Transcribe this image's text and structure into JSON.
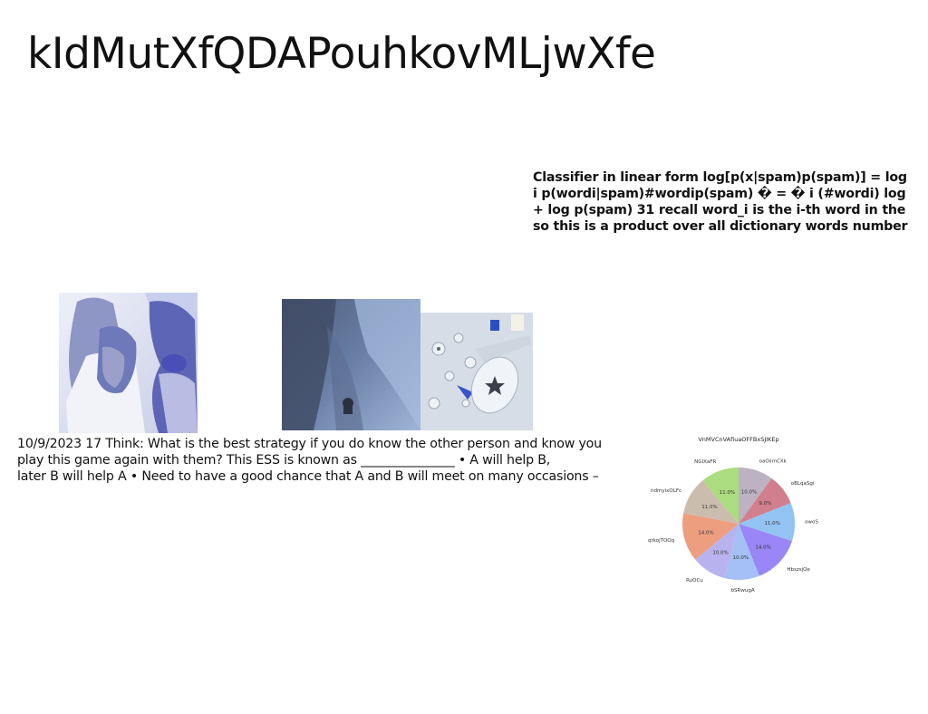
{
  "title": "kIdMutXfQDAPouhkovMLjwXfe",
  "classifier": {
    "lines": [
      "Classifier in linear form log[p(x|spam)p(spam)] = log",
      "i p(wordi|spam)#wordip(spam) � = � i (#wordi) log",
      "+ log p(spam) 31 recall word_i is the i-th word in the",
      "so this is a product over all dictionary words number"
    ]
  },
  "body": {
    "lines": [
      "10/9/2023 17 Think: What is the best strategy if you do know the other person and know you",
      "play this game again with them? This ESS is known as _______________ • A will help B,",
      "later B will help A • Need to have a good chance that A and B will meet on many occasions –"
    ]
  },
  "images": [
    {
      "icon": "portrait-photo"
    },
    {
      "icon": "landscape-photo"
    },
    {
      "icon": "toys-photo"
    }
  ],
  "chart_data": {
    "type": "pie",
    "title": "VnMVCnVAfiuaOFFBxSJIKEp",
    "slices": [
      {
        "label": "oaOiimCXk",
        "value": 10.0,
        "pct": "10.0%",
        "color": "#bcb2c2"
      },
      {
        "label": "oBLqaSgi",
        "value": 9.0,
        "pct": "9.0%",
        "color": "#d17f8e"
      },
      {
        "label": "owoS",
        "value": 11.0,
        "pct": "11.0%",
        "color": "#93c3f3"
      },
      {
        "label": "HbszsjQe",
        "value": 14.0,
        "pct": "14.0%",
        "color": "#9a86f6"
      },
      {
        "label": "bSRwugA",
        "value": 10.0,
        "pct": "10.0%",
        "color": "#a4c0f5"
      },
      {
        "label": "RuOCu",
        "value": 10.0,
        "pct": "10.0%",
        "color": "#b8b2ee"
      },
      {
        "label": "qrkojTOQq",
        "value": 14.0,
        "pct": "14.0%",
        "color": "#ec9e7f"
      },
      {
        "label": "ndmyixOLFc",
        "value": 11.0,
        "pct": "11.0%",
        "color": "#cbbdad"
      },
      {
        "label": "NGIXaFR",
        "value": 11.0,
        "pct": "11.0%",
        "color": "#abdc7f"
      }
    ]
  }
}
